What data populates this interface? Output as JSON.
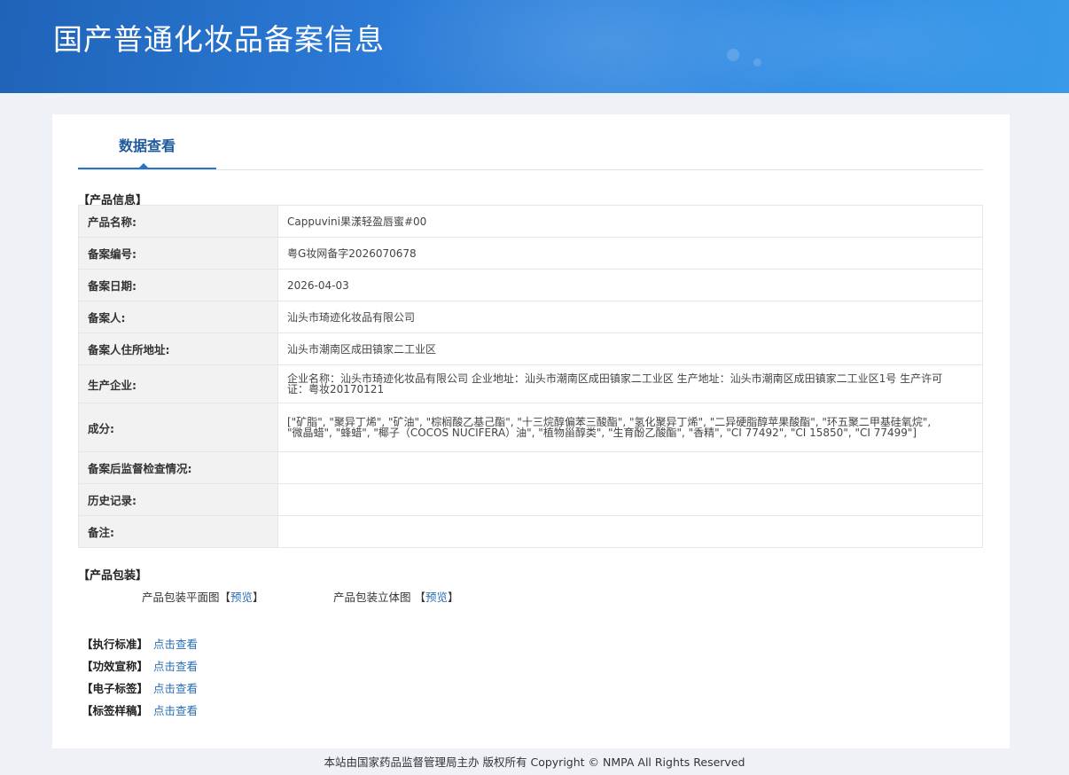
{
  "header": {
    "title": "国产普通化妆品备案信息"
  },
  "tabs": [
    {
      "label": "数据查看"
    }
  ],
  "product_info": {
    "section_label": "【产品信息】",
    "rows": [
      {
        "label": "产品名称:",
        "value": "Cappuvini果漾轻盈唇蜜#00"
      },
      {
        "label": "备案编号:",
        "value": "粤G妆网备字2026070678"
      },
      {
        "label": "备案日期:",
        "value": "2026-04-03"
      },
      {
        "label": "备案人:",
        "value": "汕头市琦迹化妆品有限公司"
      },
      {
        "label": "备案人住所地址:",
        "value": "汕头市潮南区成田镇家二工业区"
      },
      {
        "label": "生产企业:",
        "value": "企业名称：汕头市琦迹化妆品有限公司 企业地址：汕头市潮南区成田镇家二工业区 生产地址：汕头市潮南区成田镇家二工业区1号 生产许可证：粤妆20170121"
      },
      {
        "label": "成分:",
        "value": "[\"矿脂\", \"聚异丁烯\", \"矿油\", \"棕榈酸乙基己酯\", \"十三烷醇偏苯三酸酯\", \"氢化聚异丁烯\", \"二异硬脂醇苹果酸酯\", \"环五聚二甲基硅氧烷\", \"微晶蜡\", \"蜂蜡\", \"椰子（COCOS NUCIFERA）油\", \"植物甾醇类\", \"生育酚乙酸酯\", \"香精\", \"CI 77492\", \"CI 15850\", \"CI 77499\"]"
      },
      {
        "label": "备案后监督检查情况:",
        "value": ""
      },
      {
        "label": "历史记录:",
        "value": ""
      },
      {
        "label": "备注:",
        "value": ""
      }
    ]
  },
  "packaging": {
    "section_label": "【产品包装】",
    "flat_label": "产品包装平面图",
    "flat_preview": "预览",
    "solid_label": "产品包装立体图",
    "solid_preview": "预览",
    "bracket_open": "【",
    "bracket_close": "】"
  },
  "links": [
    {
      "label": "【执行标准】",
      "action": "点击查看"
    },
    {
      "label": "【功效宣称】",
      "action": "点击查看"
    },
    {
      "label": "【电子标签】",
      "action": "点击查看"
    },
    {
      "label": "【标签样稿】",
      "action": "点击查看"
    }
  ],
  "footer": {
    "text": "本站由国家药品监督管理局主办 版权所有 Copyright © NMPA All Rights Reserved"
  },
  "colors": {
    "banner": "#2b7ad6",
    "tab_accent": "#2b74c5",
    "link": "#2a6db3",
    "table_border": "#a7c1db"
  }
}
